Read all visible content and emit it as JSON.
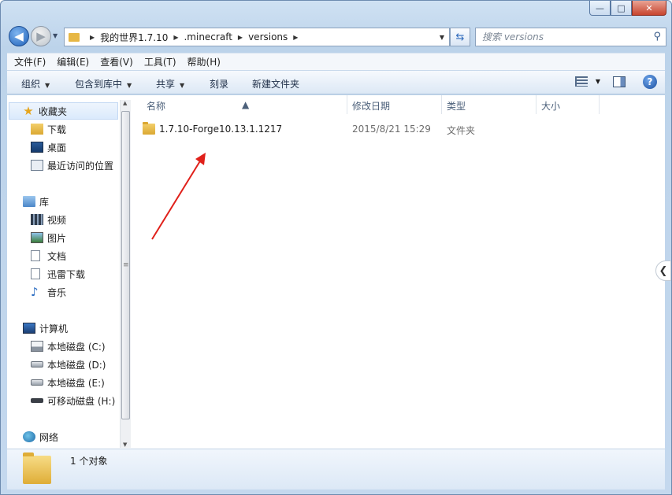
{
  "window": {
    "minimize": "—",
    "maximize": "□",
    "close": "✕"
  },
  "nav": {
    "back": "◀",
    "forward": "▶",
    "breadcrumbs": [
      "我的世界1.7.10",
      ".minecraft",
      "versions"
    ],
    "search_placeholder": "搜索 versions"
  },
  "menu": [
    "文件(F)",
    "编辑(E)",
    "查看(V)",
    "工具(T)",
    "帮助(H)"
  ],
  "toolbar": {
    "organize": "组织",
    "include_library": "包含到库中",
    "share": "共享",
    "burn": "刻录",
    "new_folder": "新建文件夹",
    "help": "?"
  },
  "sidebar": {
    "favorites": {
      "label": "收藏夹",
      "items": [
        "下载",
        "桌面",
        "最近访问的位置"
      ]
    },
    "libraries": {
      "label": "库",
      "items": [
        "视频",
        "图片",
        "文档",
        "迅雷下载",
        "音乐"
      ]
    },
    "computer": {
      "label": "计算机",
      "items": [
        "本地磁盘 (C:)",
        "本地磁盘 (D:)",
        "本地磁盘 (E:)",
        "可移动磁盘 (H:)"
      ]
    },
    "network": {
      "label": "网络"
    }
  },
  "columns": {
    "name": "名称",
    "modified": "修改日期",
    "type": "类型",
    "size": "大小"
  },
  "files": [
    {
      "name": "1.7.10-Forge10.13.1.1217",
      "modified": "2015/8/21 15:29",
      "type": "文件夹",
      "size": ""
    }
  ],
  "details": {
    "count": "1 个对象"
  },
  "colors": {
    "annotation_arrow": "#e0201a",
    "accent": "#2061b8"
  }
}
